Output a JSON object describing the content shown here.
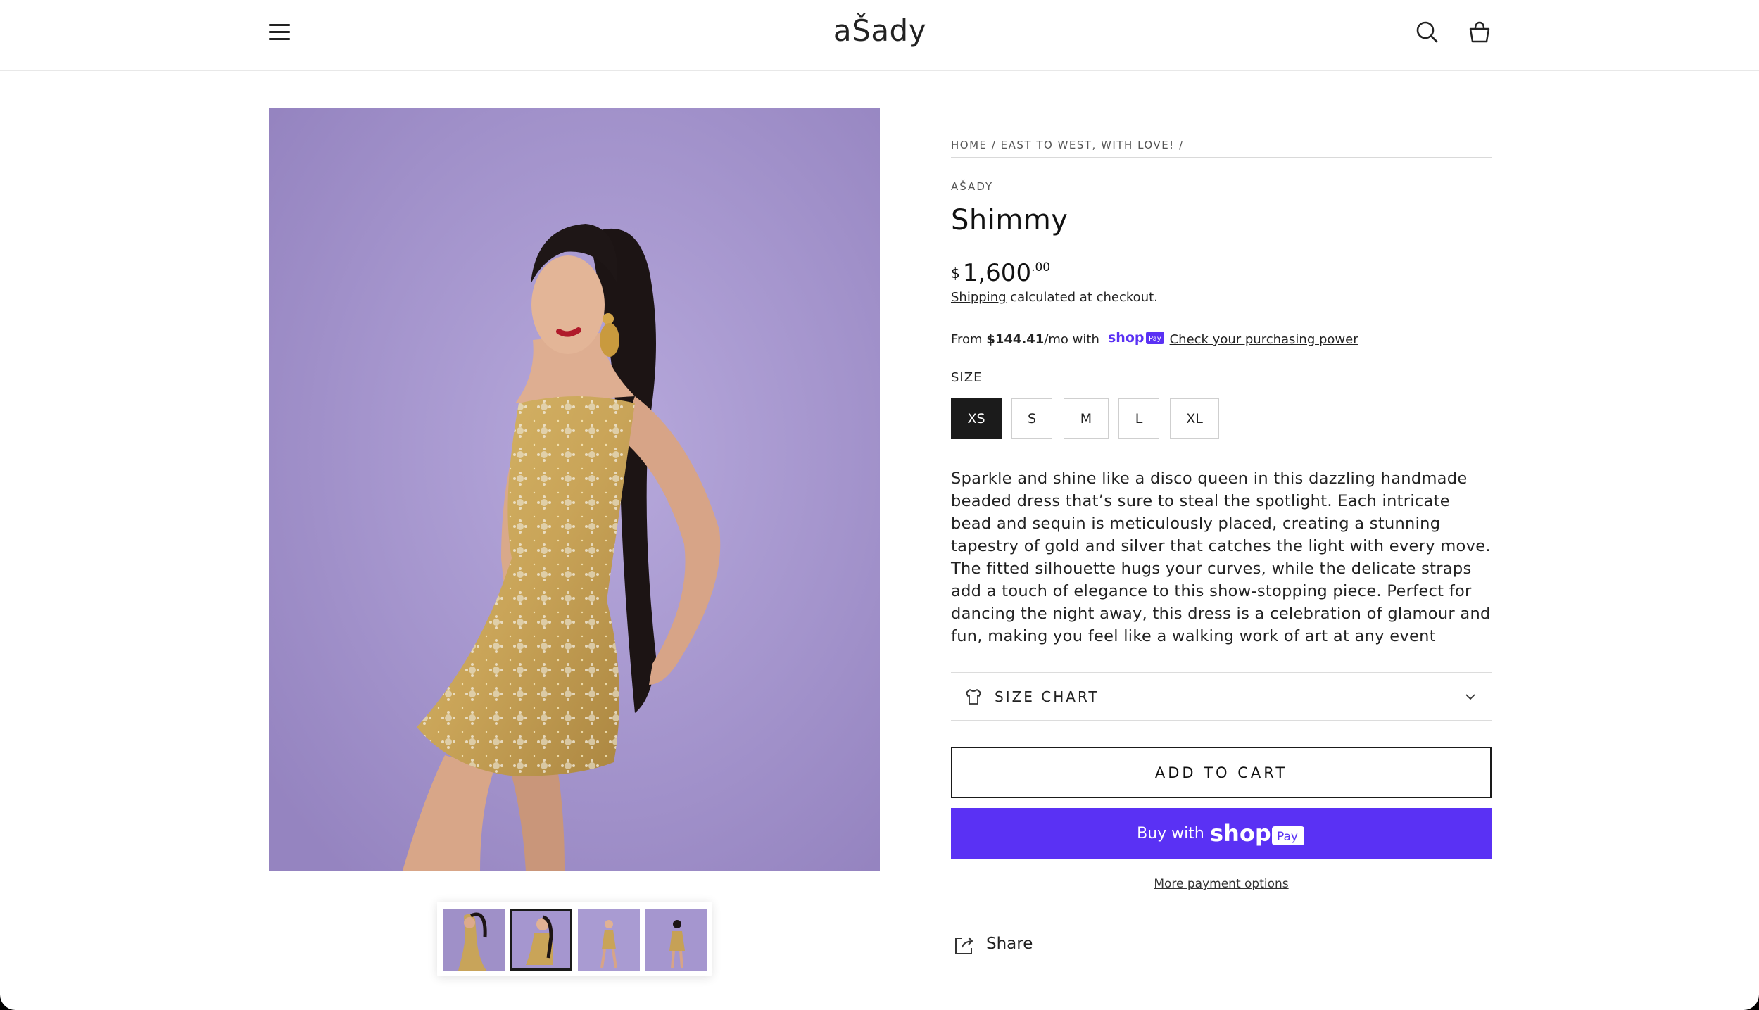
{
  "header": {
    "logo": "aŠady",
    "menu_icon": "hamburger-menu-icon",
    "search_icon": "search-icon",
    "cart_icon": "shopping-bag-icon"
  },
  "breadcrumb": {
    "home": "HOME",
    "sep": "/",
    "collection": "EAST TO WEST, WITH LOVE!"
  },
  "product": {
    "vendor": "AŠADY",
    "title": "Shimmy",
    "price": {
      "currency": "$",
      "amount": "1,600",
      "decimals": ".00"
    },
    "shipping_link": "Shipping",
    "shipping_note": "calculated at checkout.",
    "installment": {
      "prefix": "From",
      "amount": "$144.41",
      "suffix": "/mo with",
      "link": "Check your purchasing power"
    },
    "size_label": "SIZE",
    "sizes": [
      "XS",
      "S",
      "M",
      "L",
      "XL"
    ],
    "selected_size": "XS",
    "description": "Sparkle and shine like a disco queen in this dazzling handmade beaded dress that’s sure to steal the spotlight. Each intricate bead and sequin is meticulously placed, creating a stunning tapestry of gold and silver that catches the light with every move. The fitted silhouette hugs your curves, while the delicate straps add a touch of elegance to this show-stopping piece. Perfect for dancing the night away, this dress is a celebration of glamour and fun, making you feel like a walking work of art at any event",
    "size_chart_label": "SIZE CHART",
    "add_to_cart": "ADD TO CART",
    "buy_with": "Buy with",
    "more_payment": "More payment options",
    "share": "Share"
  },
  "gallery": {
    "thumbnail_count": 4,
    "active_index": 1
  },
  "colors": {
    "shop_pay": "#5a31f4",
    "selected_size_bg": "#1b1b1b",
    "photo_background": "#a99ad0"
  }
}
